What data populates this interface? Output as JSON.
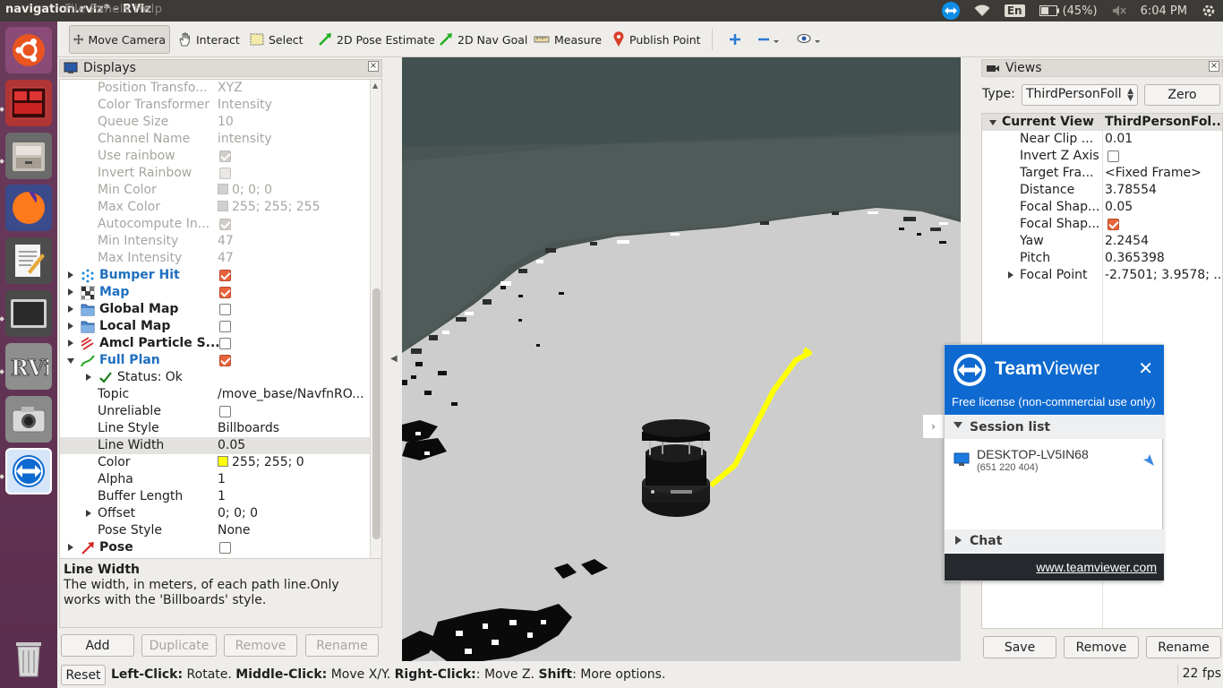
{
  "topbar": {
    "app_title": "navigation.rviz* - RViz",
    "menu_overlay": "File  Panels  Help",
    "tray": {
      "language": "En",
      "battery": "(45%)",
      "time": "6:04 PM"
    }
  },
  "launcher": {
    "items": [
      "ubuntu-icon",
      "terminal-icon",
      "files-icon",
      "firefox-icon",
      "text-editor-icon",
      "screen-icon",
      "rviz-icon",
      "camera-icon",
      "teamviewer-icon",
      "trash-icon"
    ]
  },
  "toolbar": {
    "tools": [
      {
        "label": "Move Camera",
        "icon": "move-camera-icon"
      },
      {
        "label": "Interact",
        "icon": "hand-icon"
      },
      {
        "label": "Select",
        "icon": "select-icon"
      },
      {
        "label": "2D Pose Estimate",
        "icon": "pose-arrow-icon"
      },
      {
        "label": "2D Nav Goal",
        "icon": "goal-arrow-icon"
      },
      {
        "label": "Measure",
        "icon": "ruler-icon"
      },
      {
        "label": "Publish Point",
        "icon": "pin-icon"
      }
    ]
  },
  "displays": {
    "title": "Displays",
    "rows": [
      {
        "name": "Position Transfo...",
        "value": "XYZ"
      },
      {
        "name": "Color Transformer",
        "value": "Intensity"
      },
      {
        "name": "Queue Size",
        "value": "10"
      },
      {
        "name": "Channel Name",
        "value": "intensity"
      },
      {
        "name": "Use rainbow",
        "value": ""
      },
      {
        "name": "Invert Rainbow",
        "value": ""
      },
      {
        "name": "Min Color",
        "value": "0; 0; 0"
      },
      {
        "name": "Max Color",
        "value": "255; 255; 255"
      },
      {
        "name": "Autocompute In...",
        "value": ""
      },
      {
        "name": "Min Intensity",
        "value": "47"
      },
      {
        "name": "Max Intensity",
        "value": "47"
      },
      {
        "name": "Bumper Hit",
        "value": ""
      },
      {
        "name": "Map",
        "value": ""
      },
      {
        "name": "Global Map",
        "value": ""
      },
      {
        "name": "Local Map",
        "value": ""
      },
      {
        "name": "Amcl Particle S...",
        "value": ""
      },
      {
        "name": "Full Plan",
        "value": ""
      },
      {
        "name": "Status: Ok",
        "value": ""
      },
      {
        "name": "Topic",
        "value": "/move_base/NavfnRO..."
      },
      {
        "name": "Unreliable",
        "value": ""
      },
      {
        "name": "Line Style",
        "value": "Billboards"
      },
      {
        "name": "Line Width",
        "value": "0.05"
      },
      {
        "name": "Color",
        "value": "255; 255; 0"
      },
      {
        "name": "Alpha",
        "value": "1"
      },
      {
        "name": "Buffer Length",
        "value": "1"
      },
      {
        "name": "Offset",
        "value": "0; 0; 0"
      },
      {
        "name": "Pose Style",
        "value": "None"
      },
      {
        "name": "Pose",
        "value": ""
      }
    ],
    "help_title": "Line Width",
    "help_text": "The width, in meters, of each path line.Only works with the 'Billboards' style.",
    "buttons": {
      "add": "Add",
      "duplicate": "Duplicate",
      "remove": "Remove",
      "rename": "Rename"
    }
  },
  "views": {
    "title": "Views",
    "type_label": "Type:",
    "type_value": "ThirdPersonFoll",
    "zero_label": "Zero",
    "header": {
      "name": "Current View",
      "value": "ThirdPersonFol..."
    },
    "rows": [
      {
        "name": "Near Clip ...",
        "value": "0.01"
      },
      {
        "name": "Invert Z Axis",
        "value": ""
      },
      {
        "name": "Target Fra...",
        "value": "<Fixed Frame>"
      },
      {
        "name": "Distance",
        "value": "3.78554"
      },
      {
        "name": "Focal Shap...",
        "value": "0.05"
      },
      {
        "name": "Focal Shap...",
        "value": ""
      },
      {
        "name": "Yaw",
        "value": "2.2454"
      },
      {
        "name": "Pitch",
        "value": "0.365398"
      },
      {
        "name": "Focal Point",
        "value": "-2.7501; 3.9578; ..."
      }
    ],
    "buttons": {
      "save": "Save",
      "remove": "Remove",
      "rename": "Rename"
    }
  },
  "teamviewer": {
    "brand_a": "Team",
    "brand_b": "Viewer",
    "license": "Free license (non-commercial use only)",
    "session_list": "Session list",
    "device_name": "DESKTOP-LV5IN68",
    "device_id": "(651 220 404)",
    "chat": "Chat",
    "link": "www.teamviewer.com"
  },
  "statusbar": {
    "reset": "Reset",
    "k1": "Left-Click:",
    "v1": " Rotate. ",
    "k2": "Middle-Click:",
    "v2": " Move X/Y. ",
    "k3": "Right-Click:",
    "v3": ": Move Z. ",
    "k4": "Shift",
    "v4": ": More options.",
    "fps": "22 fps"
  },
  "colors": {
    "ubuntu_topbar": "#3c3b37",
    "launcher": "#5a2e4e",
    "checkbox_checked": "#e9643b",
    "teamviewer_blue": "#0e6ad0",
    "path_yellow": "#ffff00"
  }
}
